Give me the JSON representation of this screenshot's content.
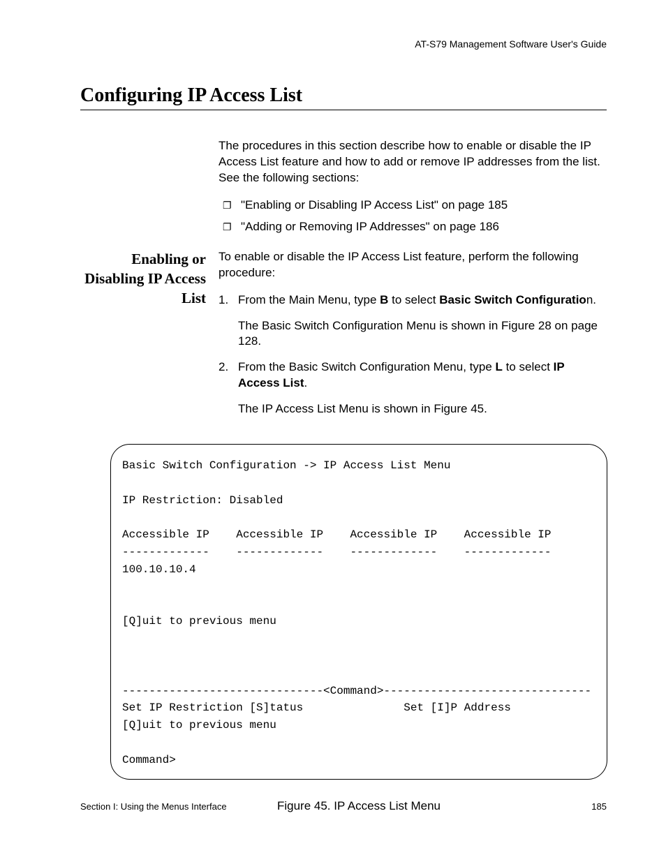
{
  "header": {
    "guide_title": "AT-S79 Management Software User's Guide"
  },
  "title": "Configuring IP Access List",
  "intro": "The procedures in this section describe how to enable or disable the IP Access List feature and how to add or remove IP addresses from the list. See the following sections:",
  "bullets": [
    "\"Enabling or Disabling IP Access List\" on page 185",
    "\"Adding or Removing IP Addresses\" on page 186"
  ],
  "section": {
    "side_heading": "Enabling or Disabling IP Access List",
    "lead": "To enable or disable the IP Access List feature, perform the following procedure:",
    "steps": [
      {
        "num": "1.",
        "pre": "From the Main Menu, type ",
        "bold1": "B",
        "mid": " to select ",
        "bold2": "Basic Switch Configuratio",
        "post": "n.",
        "sub": "The Basic Switch Configuration Menu is shown in Figure 28 on page 128."
      },
      {
        "num": "2.",
        "pre": "From the Basic Switch Configuration Menu, type ",
        "bold1": "L",
        "mid": " to select ",
        "bold2": "IP Access List",
        "post": ".",
        "sub": "The IP Access List Menu is shown in Figure 45."
      }
    ]
  },
  "figure": {
    "lines": "Basic Switch Configuration -> IP Access List Menu\n\nIP Restriction: Disabled\n\nAccessible IP    Accessible IP    Accessible IP    Accessible IP\n-------------    -------------    -------------    -------------\n100.10.10.4\n\n\n[Q]uit to previous menu\n\n\n\n------------------------------<Command>-------------------------------\nSet IP Restriction [S]tatus               Set [I]P Address\n[Q]uit to previous menu\n\nCommand>",
    "caption": "Figure 45. IP Access List Menu"
  },
  "footer": {
    "section": "Section I: Using the Menus Interface",
    "page": "185"
  }
}
